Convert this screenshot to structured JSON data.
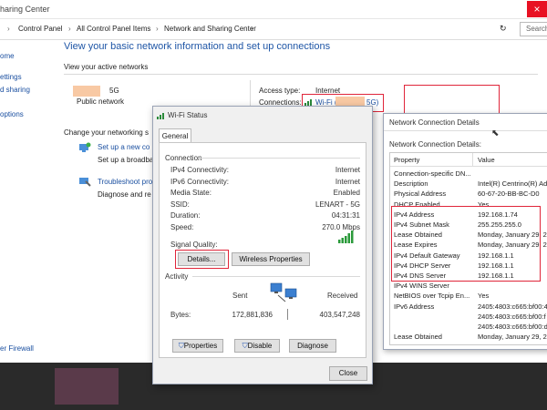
{
  "window": {
    "title": "haring Center",
    "close": "×"
  },
  "breadcrumb": [
    "Control Panel",
    "All Control Panel Items",
    "Network and Sharing Center"
  ],
  "search": {
    "placeholder": "Search"
  },
  "sidebar": {
    "items": [
      "ome",
      "ettings",
      "d sharing",
      "options",
      "er Firewall"
    ]
  },
  "main": {
    "heading": "View your basic network information and set up connections",
    "active_networks_label": "View your active networks",
    "network_name": "5G",
    "network_type": "Public network",
    "access_type_label": "Access type:",
    "access_type_value": "Internet",
    "connections_label": "Connections:",
    "connection_link": "Wi-Fi (",
    "connection_link_tail": "5G)",
    "change_settings_label": "Change your networking s",
    "setup_new_link": "Set up a new co",
    "setup_new_desc": "Set up a broadba",
    "troubleshoot_link": "Troubleshoot pro",
    "troubleshoot_desc": "Diagnose and re"
  },
  "wifi_status": {
    "title": "Wi-Fi Status",
    "tab": "General",
    "connection_group": "Connection",
    "rows": [
      {
        "label": "IPv4 Connectivity:",
        "value": "Internet"
      },
      {
        "label": "IPv6 Connectivity:",
        "value": "Internet"
      },
      {
        "label": "Media State:",
        "value": "Enabled"
      },
      {
        "label": "SSID:",
        "value": "LENART - 5G"
      },
      {
        "label": "Duration:",
        "value": "04:31:31"
      },
      {
        "label": "Speed:",
        "value": "270.0 Mbps"
      }
    ],
    "signal_quality_label": "Signal Quality:",
    "details_button": "Details...",
    "wireless_properties_button": "Wireless Properties",
    "activity_group": "Activity",
    "sent_label": "Sent",
    "received_label": "Received",
    "bytes_label": "Bytes:",
    "bytes_sent": "172,881,836",
    "bytes_received": "403,547,248",
    "properties_button": "Properties",
    "disable_button": "Disable",
    "diagnose_button": "Diagnose",
    "close_button": "Close"
  },
  "details": {
    "title": "Network Connection Details",
    "subtitle": "Network Connection Details:",
    "col_property": "Property",
    "col_value": "Value",
    "rows": [
      {
        "p": "Connection-specific DN...",
        "v": ""
      },
      {
        "p": "Description",
        "v": "Intel(R) Centrino(R) Adv"
      },
      {
        "p": "Physical Address",
        "v": "60-67-20-BB-BC-D0"
      },
      {
        "p": "DHCP Enabled",
        "v": "Yes"
      },
      {
        "p": "IPv4 Address",
        "v": "192.168.1.74"
      },
      {
        "p": "IPv4 Subnet Mask",
        "v": "255.255.255.0"
      },
      {
        "p": "Lease Obtained",
        "v": "Monday, January 29, 20"
      },
      {
        "p": "Lease Expires",
        "v": "Monday, January 29, 20"
      },
      {
        "p": "IPv4 Default Gateway",
        "v": "192.168.1.1"
      },
      {
        "p": "IPv4 DHCP Server",
        "v": "192.168.1.1"
      },
      {
        "p": "IPv4 DNS Server",
        "v": "192.168.1.1"
      },
      {
        "p": "IPv4 WINS Server",
        "v": ""
      },
      {
        "p": "NetBIOS over Tcpip En...",
        "v": "Yes"
      },
      {
        "p": "IPv6 Address",
        "v": "2405:4803:c665:bf00:4"
      },
      {
        "p": "",
        "v": "2405:4803:c665:bf00:f"
      },
      {
        "p": "",
        "v": "2405:4803:c665:bf00:d"
      },
      {
        "p": "Lease Obtained",
        "v": "Monday, January 29, 20"
      }
    ]
  },
  "colors": {
    "highlight_red": "#e0253a",
    "link_blue": "#1a4fa0",
    "heading_blue": "#1f56a6"
  }
}
